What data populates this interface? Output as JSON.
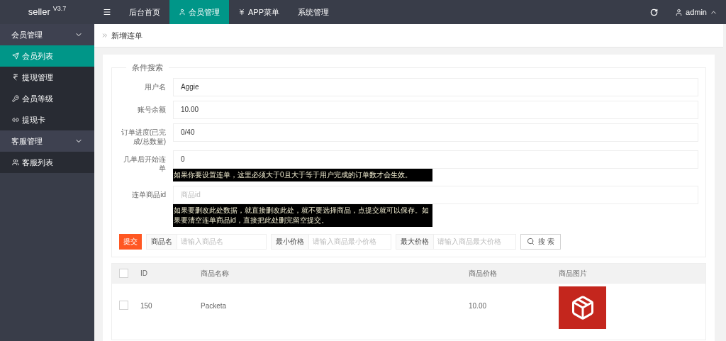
{
  "brand": {
    "name": "seller",
    "version": "V3.7"
  },
  "top_nav": [
    {
      "kind": "menu",
      "selected": false
    },
    {
      "kind": "link",
      "label": "后台首页",
      "selected": false
    },
    {
      "kind": "link",
      "label": "会员管理",
      "selected": true
    },
    {
      "kind": "link",
      "label": "APP菜单",
      "selected": false
    },
    {
      "kind": "link",
      "label": "系统管理",
      "selected": false
    }
  ],
  "user": {
    "name": "admin"
  },
  "sidebar": [
    {
      "label": "会员管理",
      "expanded": true,
      "items": [
        {
          "label": "会员列表",
          "selected": true
        },
        {
          "label": "提现管理",
          "selected": false
        },
        {
          "label": "会员等级",
          "selected": false
        },
        {
          "label": "提现卡",
          "selected": false
        }
      ]
    },
    {
      "label": "客服管理",
      "expanded": true,
      "items": [
        {
          "label": "客服列表",
          "selected": false
        }
      ]
    }
  ],
  "breadcrumb": "新增连单",
  "form": {
    "legend": "条件搜索",
    "fields": [
      {
        "label": "用户名",
        "value": "Aggie"
      },
      {
        "label": "账号余额",
        "value": "10.00"
      },
      {
        "label": "订单进度(已完成/总数量)",
        "value": "0/40"
      },
      {
        "label": "几单后开始连单",
        "value": "0",
        "hint": "如果你要设置连单，这里必须大于0且大于等于用户完成的订单数才会生效。"
      },
      {
        "label": "连单商品id",
        "placeholder": "商品id",
        "hint": "如果要删改此处数据，就直接删改此处，就不要选择商品，点提交就可以保存。如果要清空连单商品id，直接把此处删完留空提交。"
      }
    ]
  },
  "toolbar": {
    "submit": "提交",
    "filters": [
      {
        "label": "商品名",
        "placeholder": "请输入商品名"
      },
      {
        "label": "最小价格",
        "placeholder": "请输入商品最小价格"
      },
      {
        "label": "最大价格",
        "placeholder": "请输入商品最大价格"
      }
    ],
    "search": "搜 索"
  },
  "table": {
    "all_checked": false,
    "columns": [
      "ID",
      "商品名称",
      "商品价格",
      "商品图片"
    ],
    "rows": [
      {
        "checked": false,
        "id": "150",
        "name": "Packeta",
        "price": "10.00"
      }
    ]
  }
}
